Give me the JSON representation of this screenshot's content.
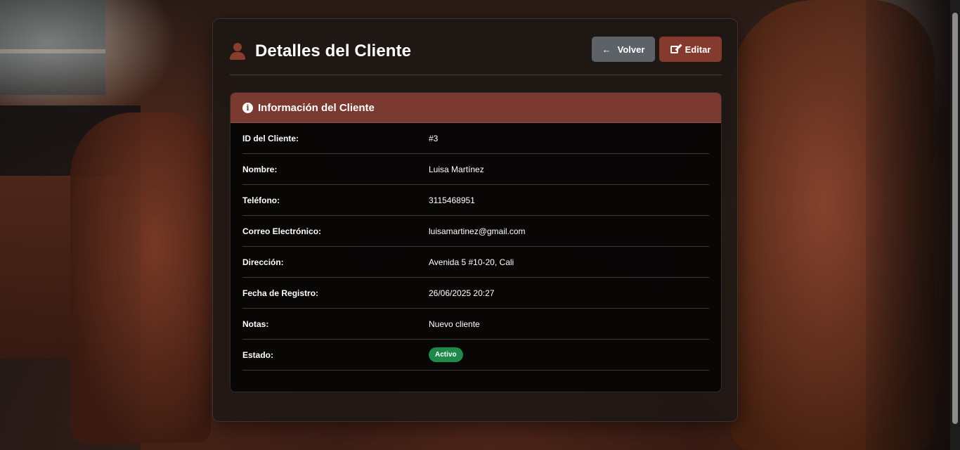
{
  "header": {
    "title": "Detalles del Cliente",
    "back_label": "Volver",
    "edit_label": "Editar"
  },
  "card": {
    "title": "Información del Cliente",
    "rows": [
      {
        "label": "ID del Cliente:",
        "value": "#3"
      },
      {
        "label": "Nombre:",
        "value": "Luisa Martínez"
      },
      {
        "label": "Teléfono:",
        "value": "3115468951"
      },
      {
        "label": "Correo Electrónico:",
        "value": "luisamartinez@gmail.com"
      },
      {
        "label": "Dirección:",
        "value": "Avenida 5 #10-20, Cali"
      },
      {
        "label": "Fecha de Registro:",
        "value": "26/06/2025 20:27"
      },
      {
        "label": "Notas:",
        "value": "Nuevo cliente"
      },
      {
        "label": "Estado:",
        "value": "Activo"
      }
    ]
  },
  "colors": {
    "accent": "#7a3a2f",
    "back_button": "#5c6268",
    "status_active": "#1d8a4a"
  },
  "icons": {
    "title": "user-icon",
    "back": "arrow-left-icon",
    "edit": "edit-icon",
    "card": "info-circle-icon"
  }
}
